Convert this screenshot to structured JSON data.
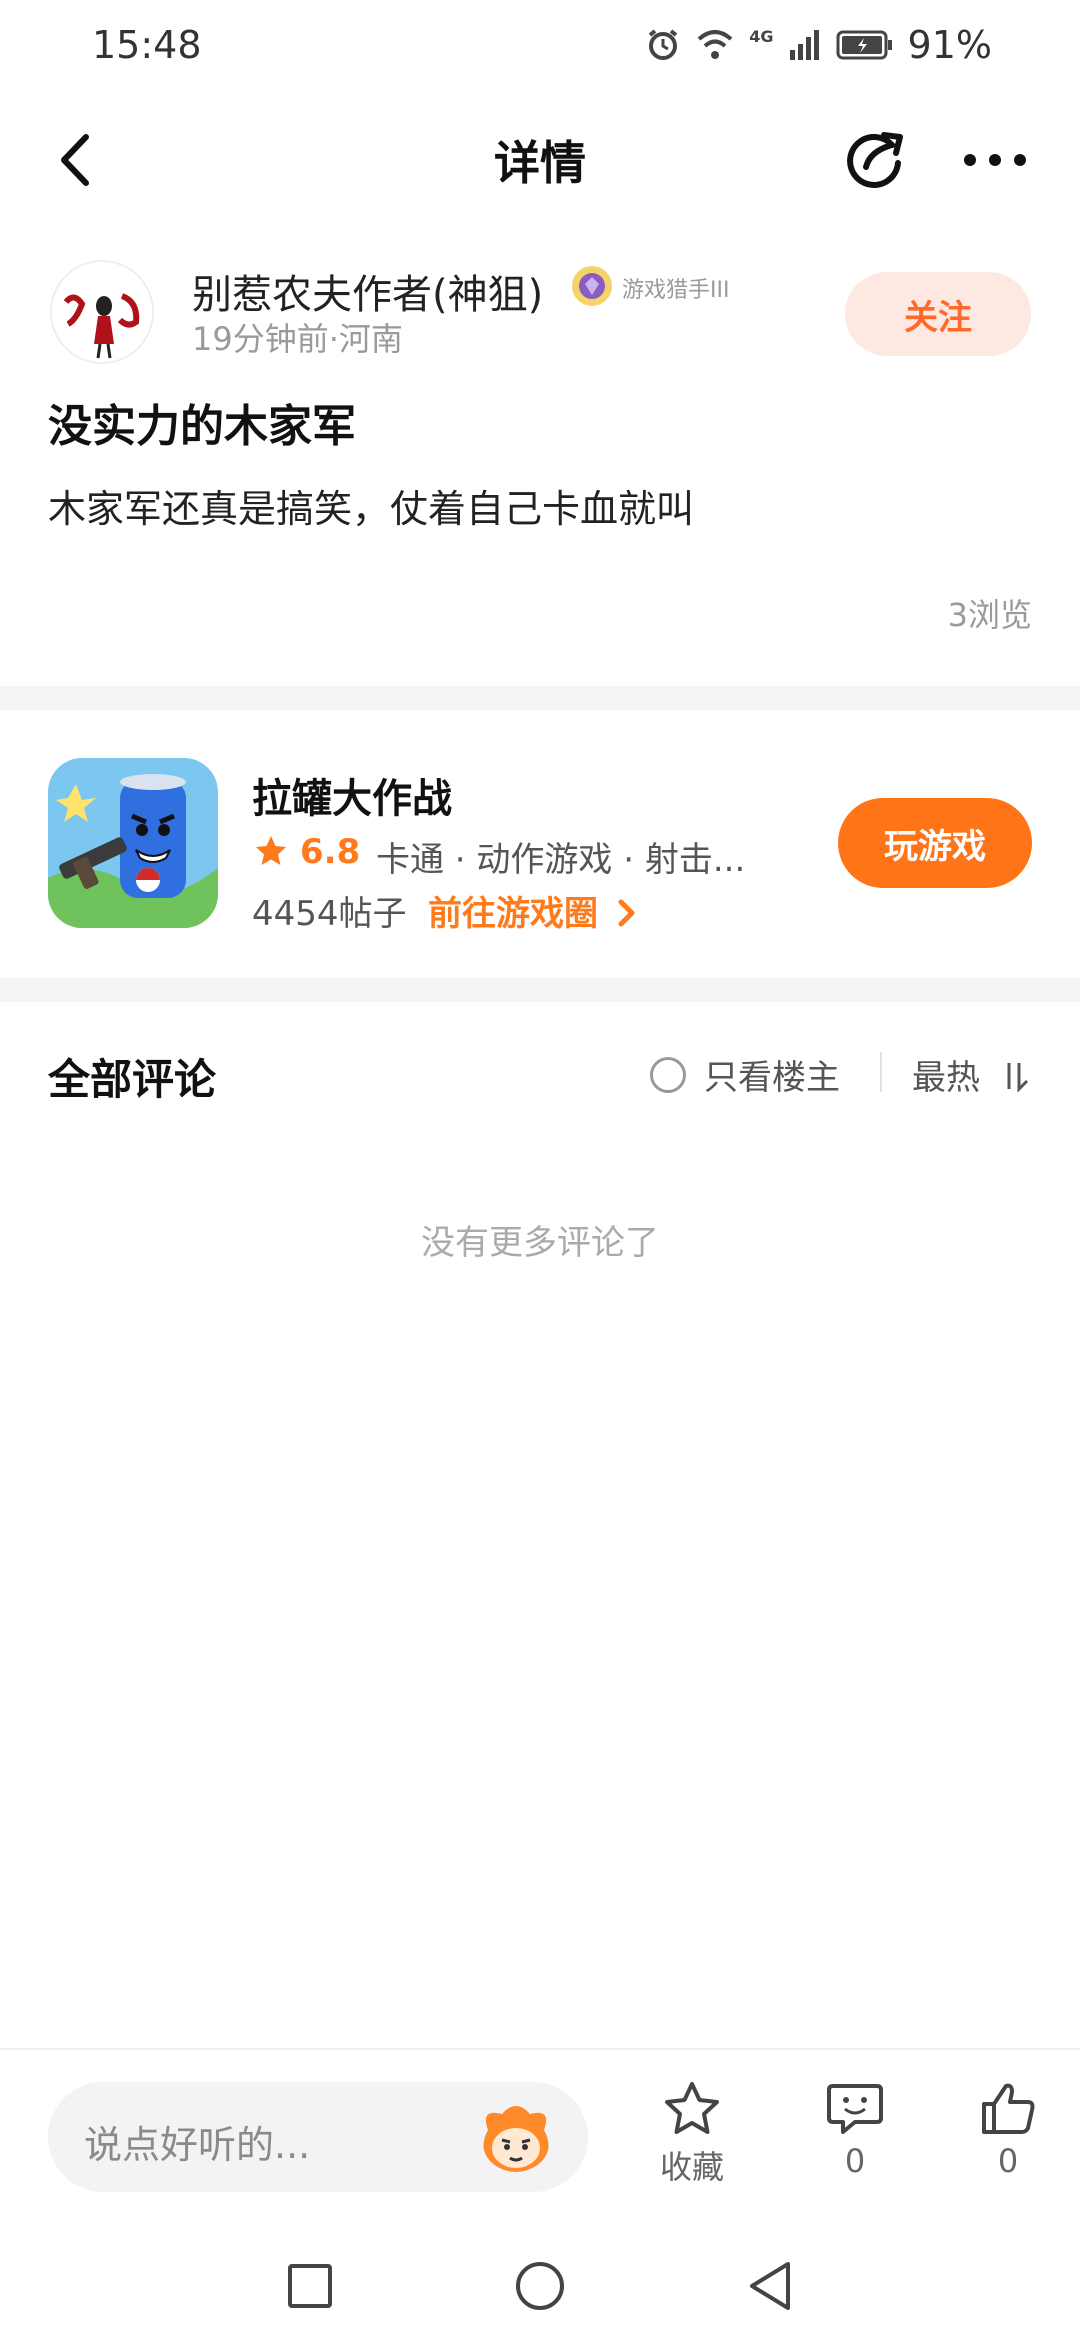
{
  "status_bar": {
    "time": "15:48",
    "network": "4G",
    "battery": "91%"
  },
  "header": {
    "title": "详情"
  },
  "post": {
    "author": "别惹农夫作者(神狙)",
    "badge": "游戏猎手III",
    "meta": "19分钟前·河南",
    "follow_label": "关注",
    "title": "没实力的木家军",
    "body": "木家军还真是搞笑，仗着自己卡血就叫",
    "views": "3浏览"
  },
  "game": {
    "name": "拉罐大作战",
    "rating": "6.8",
    "tags": "卡通 · 动作游戏 · 射击...",
    "posts": "4454帖子",
    "link_label": "前往游戏圈",
    "play_label": "玩游戏"
  },
  "comments": {
    "title": "全部评论",
    "only_op_label": "只看楼主",
    "sort_label": "最热",
    "empty_text": "没有更多评论了"
  },
  "bottom_bar": {
    "input_placeholder": "说点好听的...",
    "favorite_label": "收藏",
    "comment_count": "0",
    "like_count": "0"
  },
  "colors": {
    "accent": "#ff7417",
    "follow_bg": "#fde9e1",
    "follow_text": "#ff6a2a"
  }
}
